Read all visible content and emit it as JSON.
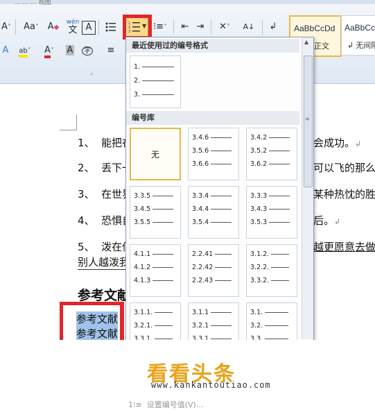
{
  "ribbon": {
    "tabs_partial": "…  …  …  视图",
    "font_grow": "A",
    "font_case": "Aa",
    "clear_format": "A",
    "pinyin": "wén",
    "char_border": "A",
    "font_color": "A",
    "enclose_char": "字",
    "styles": [
      {
        "preview": "AaBbCcDd",
        "name": "正文"
      },
      {
        "preview": "AaBbCc",
        "name": "无间隔"
      }
    ]
  },
  "numbering_dropdown": {
    "recent_title": "最近使用过的编号格式",
    "recent_items": [
      "1.",
      "2.",
      "3."
    ],
    "library_title": "编号库",
    "none_label": "无",
    "library": [
      [
        "3.4.6",
        "3.5.6",
        "3.6.6"
      ],
      [
        "3.4.2",
        "3.5.2",
        "3.6.2"
      ],
      [
        "3.3.5",
        "3.4.5",
        "3.5.5"
      ],
      [
        "3.3.4",
        "3.4.4",
        "3.5.4"
      ],
      [
        "3.3.3",
        "3.4.3",
        "3.5.3"
      ],
      [
        "4.1.1",
        "4.1.2",
        "4.1.3"
      ],
      [
        "2.2.41",
        "2.2.42",
        "2.2.43"
      ],
      [
        "3.1.2.",
        "3.2.2.",
        "3.3.2."
      ],
      [
        "3.1.1.",
        "3.2.1.",
        "3.3.1."
      ],
      [
        "3.1.1",
        "3.2.1",
        "3.3.1"
      ],
      [
        "3.1.",
        "3.2.",
        "3.3."
      ]
    ],
    "footer_partial": "设置编号值(V)..."
  },
  "document": {
    "lines": [
      {
        "num": "1、",
        "left": "能把在",
        "right": "会成功。"
      },
      {
        "num": "2、",
        "left": "丢下一",
        "right": "可以飞的那么高"
      },
      {
        "num": "3、",
        "left": "在世界",
        "right": "某种热忱的胜利"
      },
      {
        "num": "4、",
        "left": "恐惧自",
        "right": "后。"
      },
      {
        "num": "5、",
        "left": "泼在你",
        "right": "越更愿意去做一"
      }
    ],
    "line5_cont": "别人越泼我",
    "heading": "参考文献",
    "selected_lines": [
      "参考文献",
      "参考文献"
    ]
  },
  "watermark": {
    "brand": "看看头条",
    "url": "www.kankantoutiao.com"
  },
  "colors": {
    "highlight_red": "#e0262c",
    "selection_blue": "#9fc3ea",
    "selected_cell_border": "#e4b84a"
  }
}
